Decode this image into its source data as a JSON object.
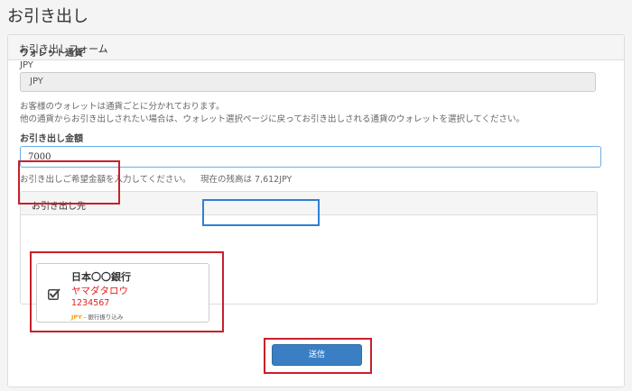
{
  "page": {
    "title": "お引き出し"
  },
  "form": {
    "header": "お引き出しフォーム",
    "wallet": {
      "label": "ウォレット通貨",
      "sub_label": "JPY",
      "value": "JPY",
      "note1": "お客様のウォレットは通貨ごとに分かれております。",
      "note2": "他の通貨からお引き出しされたい場合は、ウォレット選択ページに戻ってお引き出しされる通貨のウォレットを選択してください。"
    },
    "amount": {
      "label": "お引き出し金額",
      "value": "7000",
      "help": "お引き出しご希望金額を入力してください。",
      "balance": "現在の残高は 7,612JPY"
    },
    "destination": {
      "header": "お引き出し先",
      "bank_name": "日本〇〇銀行",
      "holder": "ヤマダタロウ",
      "account_number": "1234567",
      "currency": "JPY",
      "method": " - 銀行振り込み",
      "checked": true
    },
    "submit_label": "送信"
  },
  "colors": {
    "accent": "#3a7fc4",
    "highlight_red": "#c8202a",
    "highlight_blue": "#2f7fd6",
    "holder_text": "#e02020"
  }
}
